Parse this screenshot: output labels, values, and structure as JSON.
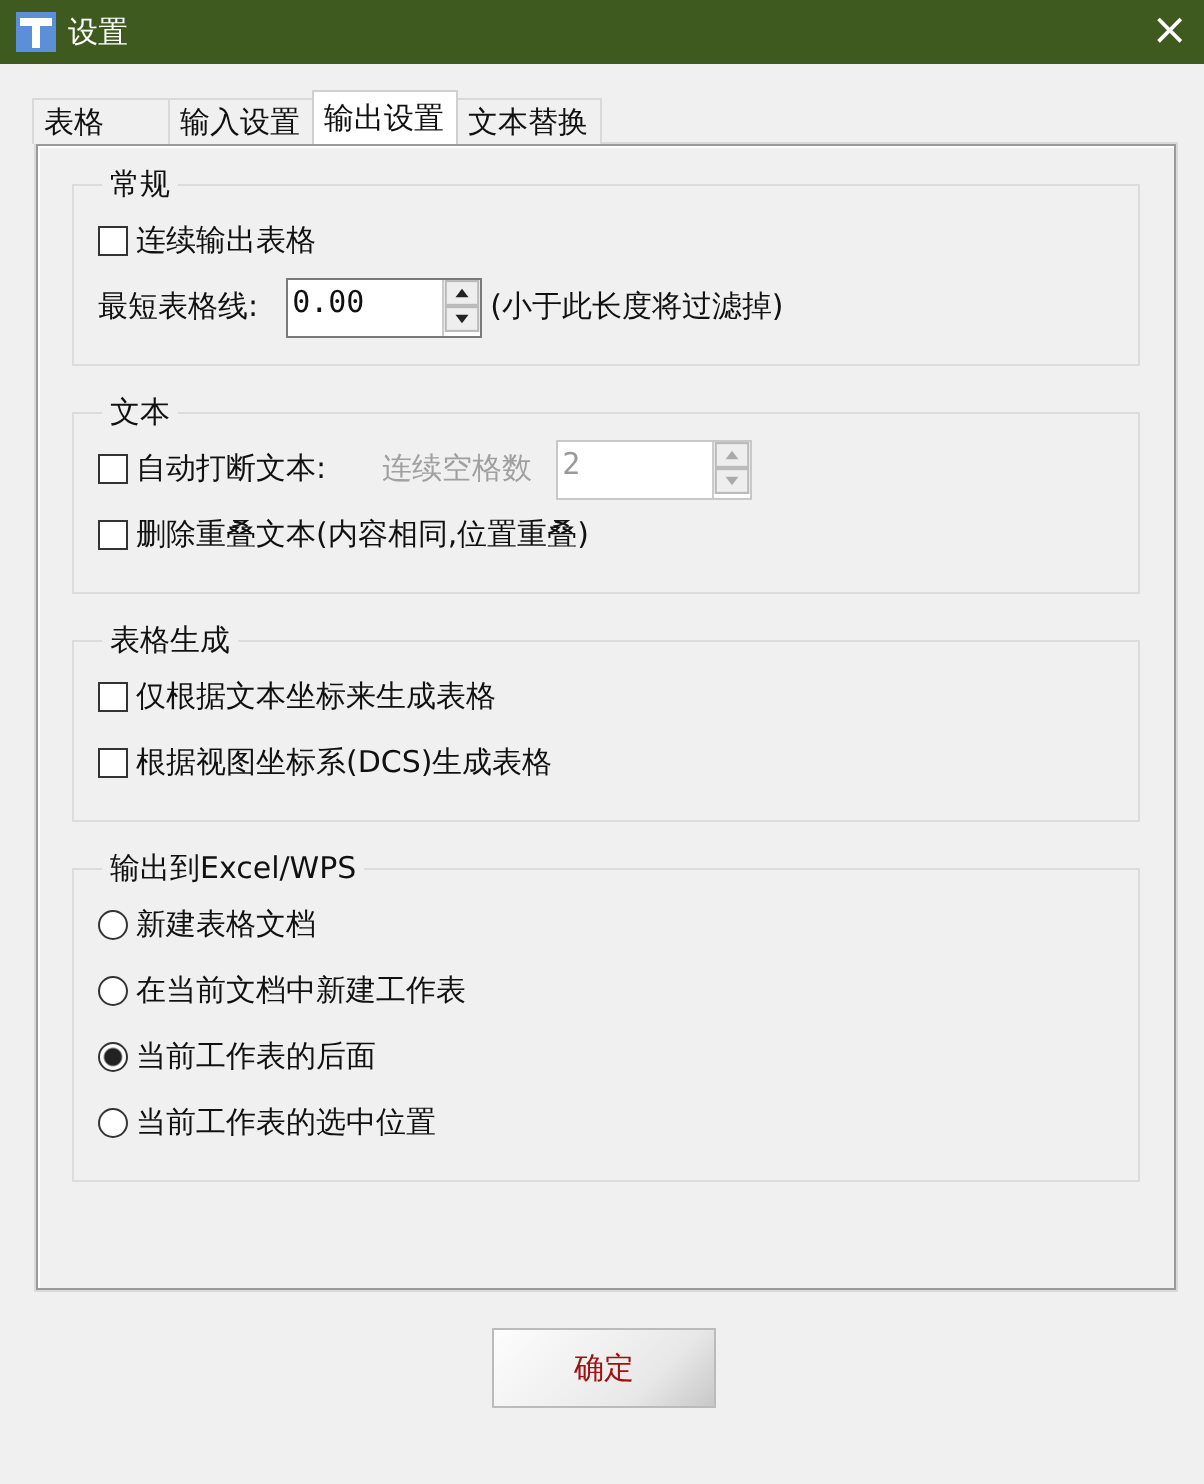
{
  "window": {
    "title": "设置",
    "close": "×"
  },
  "tabs": [
    {
      "label": "表格",
      "selected": false
    },
    {
      "label": "输入设置",
      "selected": false
    },
    {
      "label": "输出设置",
      "selected": true
    },
    {
      "label": "文本替换",
      "selected": false
    }
  ],
  "groups": [
    {
      "title": "常规",
      "items": [
        {
          "kind": "checkbox",
          "label": "连续输出表格",
          "checked": false
        },
        {
          "kind": "spin",
          "label": "最短表格线:",
          "value": "0.00",
          "disabled": false,
          "hint": "(小于此长度将过滤掉)"
        }
      ]
    },
    {
      "title": "文本",
      "items": [
        {
          "kind": "checkbox",
          "label": "自动打断文本:",
          "checked": false,
          "spin": {
            "label": "连续空格数",
            "value": "2",
            "disabled": true
          }
        },
        {
          "kind": "checkbox",
          "label": "删除重叠文本(内容相同,位置重叠)",
          "checked": false
        }
      ]
    },
    {
      "title": "表格生成",
      "items": [
        {
          "kind": "checkbox",
          "label": "仅根据文本坐标来生成表格",
          "checked": false
        },
        {
          "kind": "checkbox",
          "label": "根据视图坐标系(DCS)生成表格",
          "checked": false
        }
      ]
    },
    {
      "title": "输出到Excel/WPS",
      "items": [
        {
          "kind": "radio",
          "label": "新建表格文档",
          "selected": false
        },
        {
          "kind": "radio",
          "label": "在当前文档中新建工作表",
          "selected": false
        },
        {
          "kind": "radio",
          "label": "当前工作表的后面",
          "selected": true
        },
        {
          "kind": "radio",
          "label": "当前工作表的选中位置",
          "selected": false
        }
      ]
    }
  ],
  "ok_button": "确定"
}
